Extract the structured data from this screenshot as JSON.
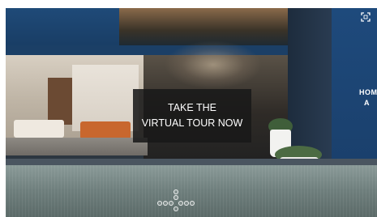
{
  "tour": {
    "cta_line1": "TAKE THE",
    "cta_line2": "VIRTUAL TOUR NOW",
    "storefront_text_line1": "HOM",
    "storefront_text_line2": "A"
  },
  "controls": {
    "fullscreen_icon": "fullscreen-corners-icon",
    "navigation_icon": "nav-dots-icon"
  },
  "colors": {
    "cta_background": "#191919",
    "cta_text": "#ffffff",
    "storefront_blue": "#1e4a7c"
  }
}
